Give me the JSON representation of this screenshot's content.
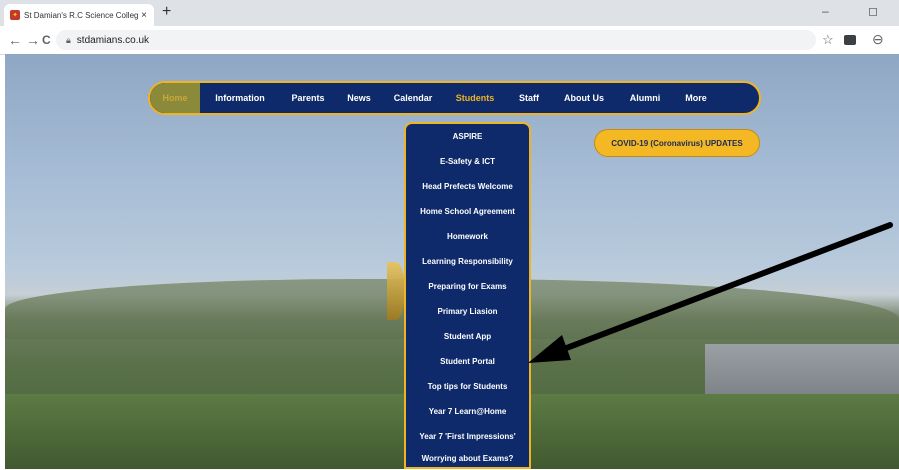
{
  "browser": {
    "tab_title": "St Damian's R.C Science College",
    "tab_close": "×",
    "new_tab": "+",
    "url": "stdamians.co.uk",
    "back": "←",
    "forward": "→",
    "reload": "C",
    "star": "☆",
    "profile": "⊖",
    "minimize": "–",
    "maximize": "◻"
  },
  "nav": {
    "items": [
      "Home",
      "Information",
      "Parents",
      "News",
      "Calendar",
      "Students",
      "Staff",
      "About Us",
      "Alumni",
      "More"
    ]
  },
  "dropdown": {
    "items": [
      "ASPIRE",
      "E-Safety & ICT",
      "Head Prefects Welcome",
      "Home School Agreement",
      "Homework",
      "Learning Responsibility",
      "Preparing for Exams",
      "Primary Liasion",
      "Student App",
      "Student Portal",
      "Top tips for Students",
      "Year 7 Learn@Home",
      "Year 7 'First Impressions'",
      "Worrying about Exams?"
    ]
  },
  "covid_button": "COVID-19 (Coronavirus) UPDATES",
  "colors": {
    "navy": "#0e2a6b",
    "gold": "#f0b323"
  }
}
